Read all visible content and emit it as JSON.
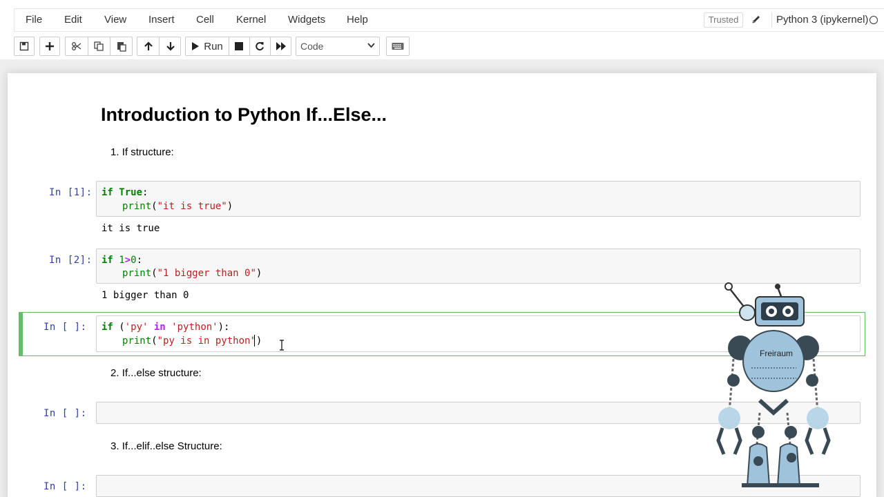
{
  "menu": {
    "items": [
      "File",
      "Edit",
      "View",
      "Insert",
      "Cell",
      "Kernel",
      "Widgets",
      "Help"
    ],
    "trusted_label": "Trusted",
    "kernel_name": "Python 3 (ipykernel)"
  },
  "toolbar": {
    "run_label": "Run",
    "cell_type": "Code"
  },
  "notebook": {
    "title": "Introduction to Python If...Else...",
    "sections": [
      {
        "number": "1.",
        "label": "If structure:"
      },
      {
        "number": "2.",
        "label": "If...else structure:"
      },
      {
        "number": "3.",
        "label": "If...elif..else Structure:"
      }
    ],
    "cells": [
      {
        "prompt": "In  [1]:",
        "line1_parts": [
          "if",
          " ",
          "True",
          ":"
        ],
        "line2_parts": [
          "print",
          "(",
          "\"it is true\"",
          ")"
        ],
        "output": "it is true"
      },
      {
        "prompt": "In  [2]:",
        "line1_parts": [
          "if",
          " ",
          "1",
          ">",
          "0",
          ":"
        ],
        "line2_parts": [
          "print",
          "(",
          "\"1 bigger than 0\"",
          ")"
        ],
        "output": "1 bigger than 0"
      },
      {
        "prompt": "In  [ ]:",
        "line1_parts": [
          "if",
          " (",
          "'py'",
          " ",
          "in",
          " ",
          "'python'",
          "):"
        ],
        "line2_parts": [
          "print",
          "(",
          "\"py is in python\"",
          ")"
        ]
      },
      {
        "prompt": "In  [ ]:"
      },
      {
        "prompt": "In  [ ]:"
      }
    ]
  },
  "overlay": {
    "robot_logo_text": "Freiraum"
  },
  "colors": {
    "keyword": "#008000",
    "string": "#ba2121",
    "prompt": "#303f9f",
    "selected_border": "#66bb6a"
  }
}
